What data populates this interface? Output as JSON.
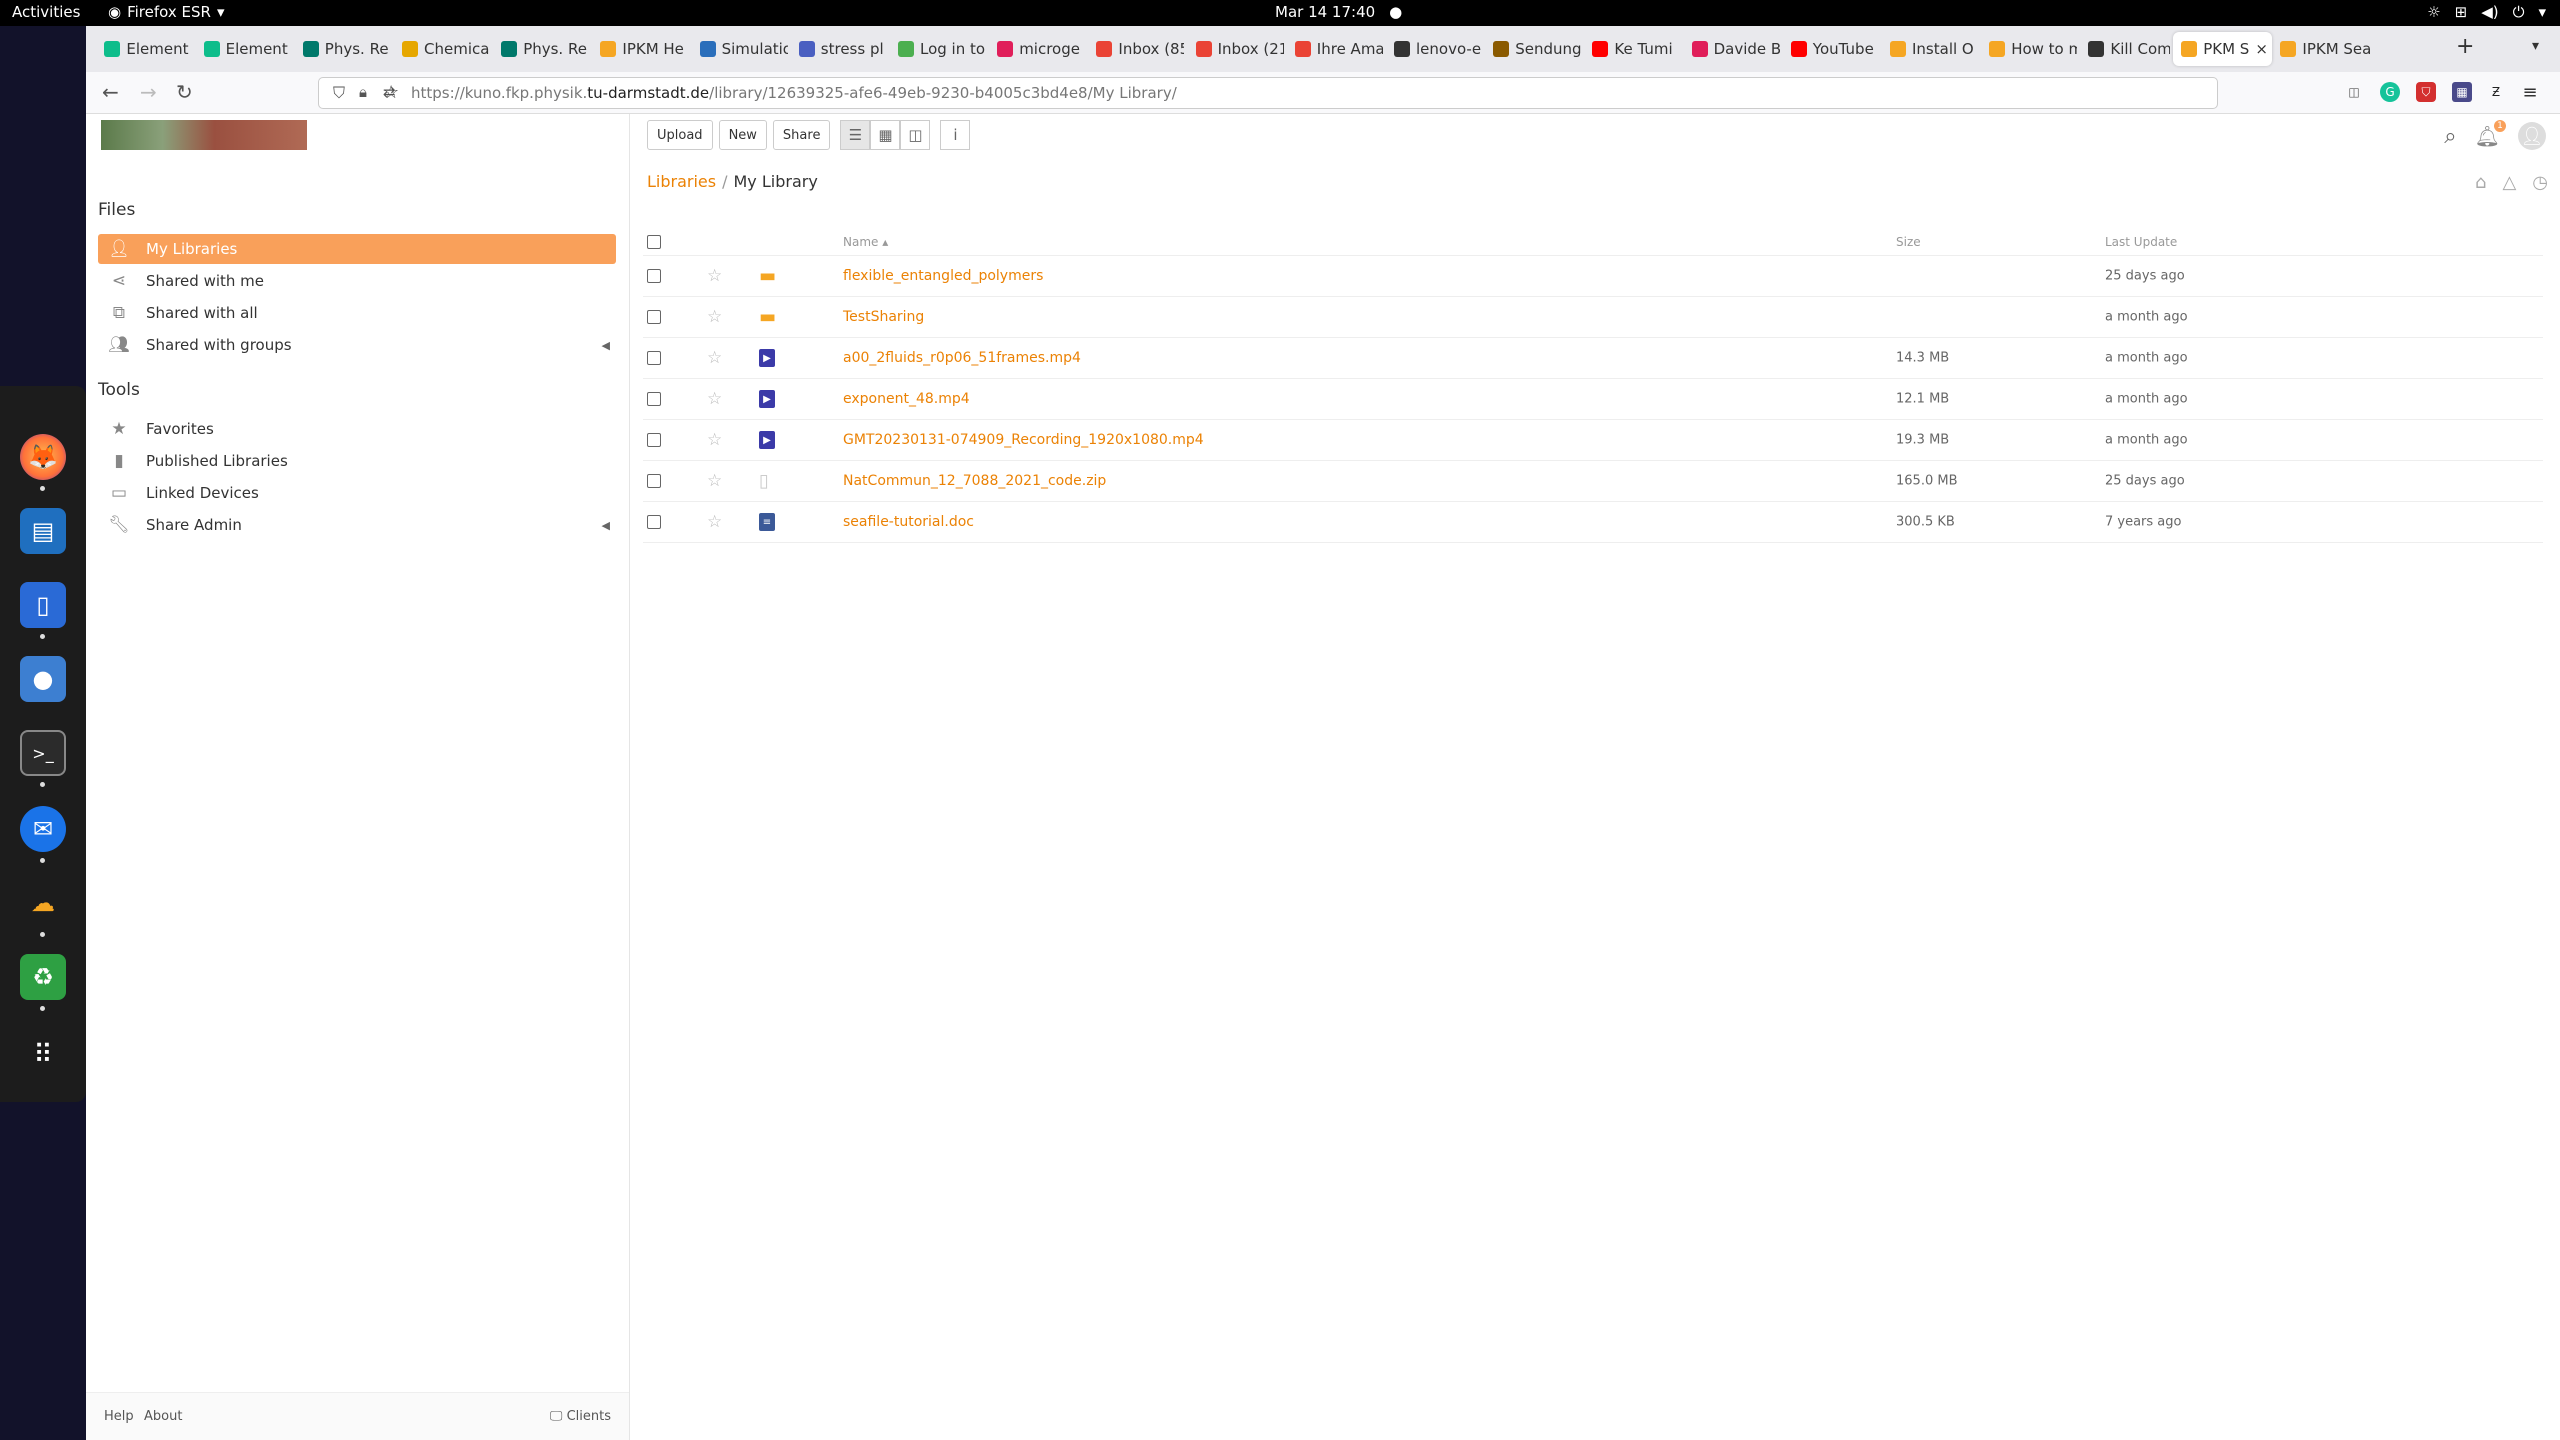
{
  "topbar": {
    "activities": "Activities",
    "app_name": "Firefox ESR",
    "datetime": "Mar 14  17:40"
  },
  "tabs": [
    {
      "label": "Element",
      "color": "#0dbd8b"
    },
    {
      "label": "Element",
      "color": "#0dbd8b"
    },
    {
      "label": "Phys. Re",
      "color": "#00796b"
    },
    {
      "label": "Chemica",
      "color": "#e6a700"
    },
    {
      "label": "Phys. Re",
      "color": "#00796b"
    },
    {
      "label": "IPKM He",
      "color": "#f5a623"
    },
    {
      "label": "Simulatio",
      "color": "#2a6ebb"
    },
    {
      "label": "stress pl",
      "color": "#4a5fc1"
    },
    {
      "label": "Log in to",
      "color": "#4caf50"
    },
    {
      "label": "microge",
      "color": "#e01e5a"
    },
    {
      "label": "Inbox (85",
      "color": "#ea4335"
    },
    {
      "label": "Inbox (21",
      "color": "#ea4335"
    },
    {
      "label": "Ihre Ama",
      "color": "#ea4335"
    },
    {
      "label": "lenovo-e",
      "color": "#333333"
    },
    {
      "label": "Sendung",
      "color": "#8a5a00"
    },
    {
      "label": "Ke Tumi",
      "color": "#ff0000"
    },
    {
      "label": "Davide B",
      "color": "#e01e5a"
    },
    {
      "label": "YouTube",
      "color": "#ff0000"
    },
    {
      "label": "Install O",
      "color": "#f5a623"
    },
    {
      "label": "How to m",
      "color": "#f5a623"
    },
    {
      "label": "Kill Com",
      "color": "#333333"
    },
    {
      "label": "PKM S",
      "color": "#f5a623",
      "active": true
    },
    {
      "label": "IPKM Sea",
      "color": "#f5a623"
    }
  ],
  "url": {
    "prefix": "https://kuno.fkp.physik.",
    "domain": "tu-darmstadt.de",
    "path": "/library/12639325-afe6-49eb-9230-b4005c3bd4e8/My Library/"
  },
  "toolbar": {
    "upload": "Upload",
    "new": "New",
    "share": "Share",
    "notification_count": "1"
  },
  "sidebar": {
    "files_heading": "Files",
    "files_items": [
      {
        "label": "My Libraries",
        "icon": "person-icon",
        "active": true
      },
      {
        "label": "Shared with me",
        "icon": "share-icon"
      },
      {
        "label": "Shared with all",
        "icon": "org-icon"
      },
      {
        "label": "Shared with groups",
        "icon": "group-icon",
        "expandable": true
      }
    ],
    "tools_heading": "Tools",
    "tools_items": [
      {
        "label": "Favorites",
        "icon": "star-icon"
      },
      {
        "label": "Published Libraries",
        "icon": "book-icon"
      },
      {
        "label": "Linked Devices",
        "icon": "monitor-icon"
      },
      {
        "label": "Share Admin",
        "icon": "wrench-icon",
        "expandable": true
      }
    ],
    "footer": {
      "help": "Help",
      "about": "About",
      "clients": "Clients"
    }
  },
  "breadcrumb": {
    "root": "Libraries",
    "sep": "/",
    "current": "My Library"
  },
  "table": {
    "headers": {
      "name": "Name ▴",
      "size": "Size",
      "last_update": "Last Update"
    },
    "rows": [
      {
        "name": "flexible_entangled_polymers",
        "type": "folder",
        "size": "",
        "updated": "25 days ago"
      },
      {
        "name": "TestSharing",
        "type": "folder",
        "size": "",
        "updated": "a month ago"
      },
      {
        "name": "a00_2fluids_r0p06_51frames.mp4",
        "type": "video",
        "size": "14.3 MB",
        "updated": "a month ago"
      },
      {
        "name": "exponent_48.mp4",
        "type": "video",
        "size": "12.1 MB",
        "updated": "a month ago"
      },
      {
        "name": "GMT20230131-074909_Recording_1920x1080.mp4",
        "type": "video",
        "size": "19.3 MB",
        "updated": "a month ago"
      },
      {
        "name": "NatCommun_12_7088_2021_code.zip",
        "type": "file",
        "size": "165.0 MB",
        "updated": "25 days ago"
      },
      {
        "name": "seafile-tutorial.doc",
        "type": "doc",
        "size": "300.5 KB",
        "updated": "7 years ago"
      }
    ]
  },
  "colors": {
    "accent": "#f9a05a",
    "link": "#eb8205"
  }
}
